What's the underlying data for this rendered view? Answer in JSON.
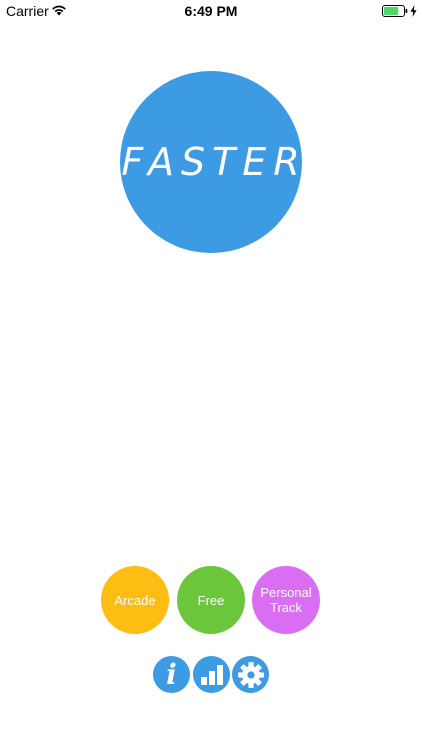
{
  "status_bar": {
    "carrier": "Carrier",
    "time": "6:49 PM",
    "battery_level": 0.75,
    "charging": true
  },
  "logo": {
    "text": "FASTER",
    "color": "#3d9be3"
  },
  "modes": [
    {
      "label": "Arcade",
      "color": "#fdbd12"
    },
    {
      "label": "Free",
      "color": "#6cc63c"
    },
    {
      "label": "Personal Track",
      "color": "#d96ef2"
    }
  ],
  "bottom_buttons": {
    "info_glyph": "i",
    "info_icon": "info-icon",
    "stats_icon": "bar-chart-icon",
    "settings_icon": "gear-icon",
    "color": "#3d9be3"
  },
  "colors": {
    "background": "#ffffff",
    "battery_fill": "#4cd964"
  }
}
